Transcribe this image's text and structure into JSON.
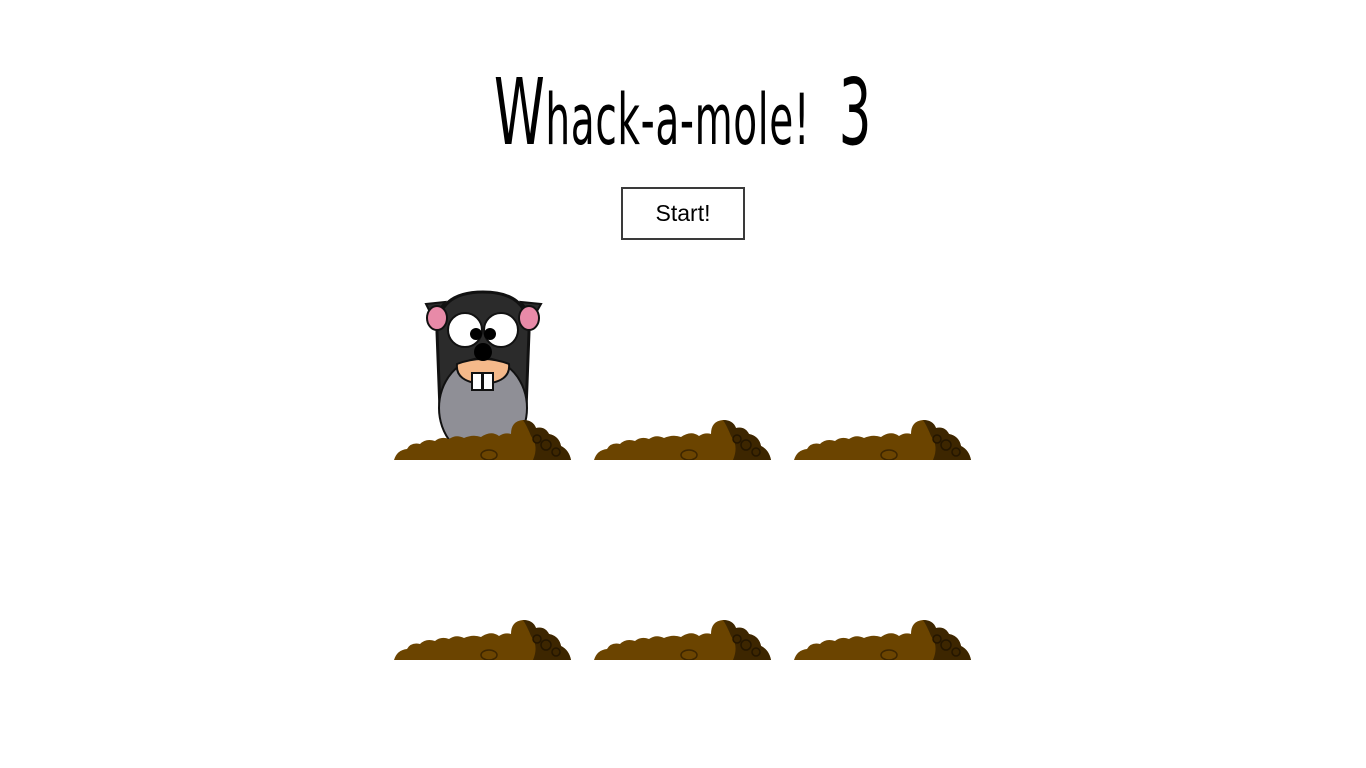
{
  "header": {
    "title_first_letter": "W",
    "title_rest": "hack-a-mole!",
    "score": "3"
  },
  "controls": {
    "start_label": "Start!"
  },
  "game": {
    "holes": [
      {
        "id": 1,
        "mole_up": true
      },
      {
        "id": 2,
        "mole_up": false
      },
      {
        "id": 3,
        "mole_up": false
      },
      {
        "id": 4,
        "mole_up": false
      },
      {
        "id": 5,
        "mole_up": false
      },
      {
        "id": 6,
        "mole_up": false
      }
    ],
    "colors": {
      "dirt": "#6b4400",
      "dirt_dark": "#3d2600",
      "mole_body": "#2b2b2b",
      "mole_belly": "#8f8f96",
      "mole_snout": "#f5b98a",
      "ear_inner": "#e88aa8"
    }
  }
}
